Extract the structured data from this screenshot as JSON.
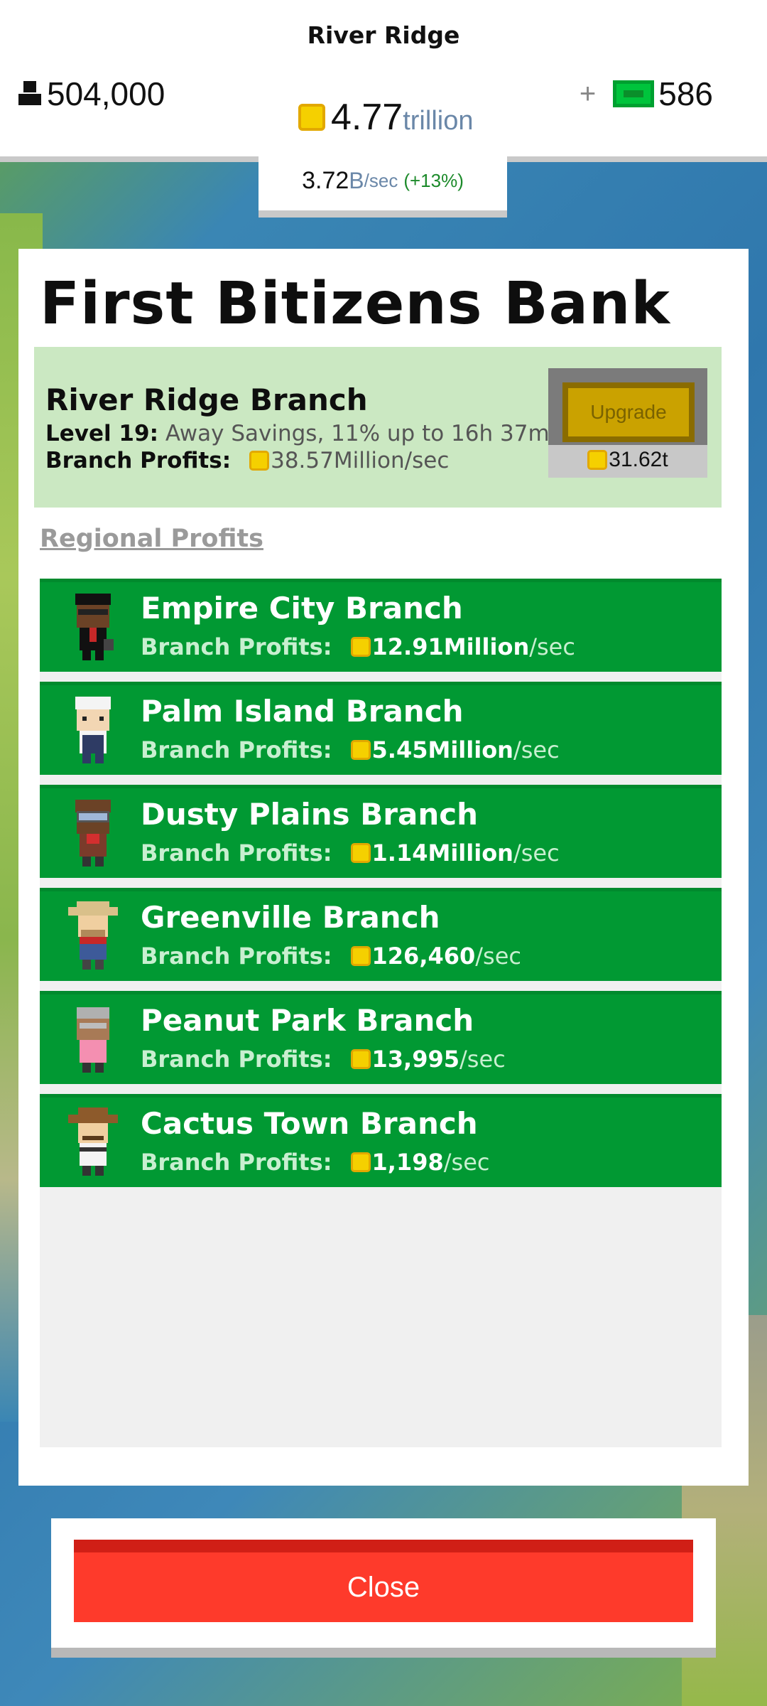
{
  "header": {
    "city": "River Ridge",
    "population": "504,000",
    "coins_value": "4.77",
    "coins_unit": "trillion",
    "plus": "+",
    "bux": "586",
    "rate_value": "3.72",
    "rate_unit": "B",
    "rate_persec": "/sec",
    "rate_change": "(+13%)"
  },
  "bank": {
    "title": "First Bitizens Bank",
    "home_branch": {
      "name": "River Ridge Branch",
      "level_label": "Level 19:",
      "level_text": "Away Savings, 11% up to 16h 37m",
      "profits_label": "Branch Profits:",
      "profits_value": "38.57Million/sec",
      "upgrade_label": "Upgrade",
      "upgrade_cost": "31.62t"
    },
    "regional_label": "Regional Profits",
    "profits_label": "Branch Profits:",
    "branches": [
      {
        "name": "Empire City Branch",
        "value": "12.91Million",
        "persec": "/sec"
      },
      {
        "name": "Palm Island Branch",
        "value": "5.45Million",
        "persec": "/sec"
      },
      {
        "name": "Dusty Plains Branch",
        "value": "1.14Million",
        "persec": "/sec"
      },
      {
        "name": "Greenville Branch",
        "value": "126,460",
        "persec": "/sec"
      },
      {
        "name": "Peanut Park Branch",
        "value": "13,995",
        "persec": "/sec"
      },
      {
        "name": "Cactus Town Branch",
        "value": "1,198",
        "persec": "/sec"
      }
    ]
  },
  "footer": {
    "close_label": "Close"
  },
  "icons": {
    "population": "person-icon",
    "coin": "coin-icon",
    "bux": "bux-icon"
  },
  "colors": {
    "branch_row": "#019933",
    "home_branch_bg": "#cbe8c2",
    "close_button": "#fe3a2b",
    "upgrade_button": "#caa200"
  }
}
